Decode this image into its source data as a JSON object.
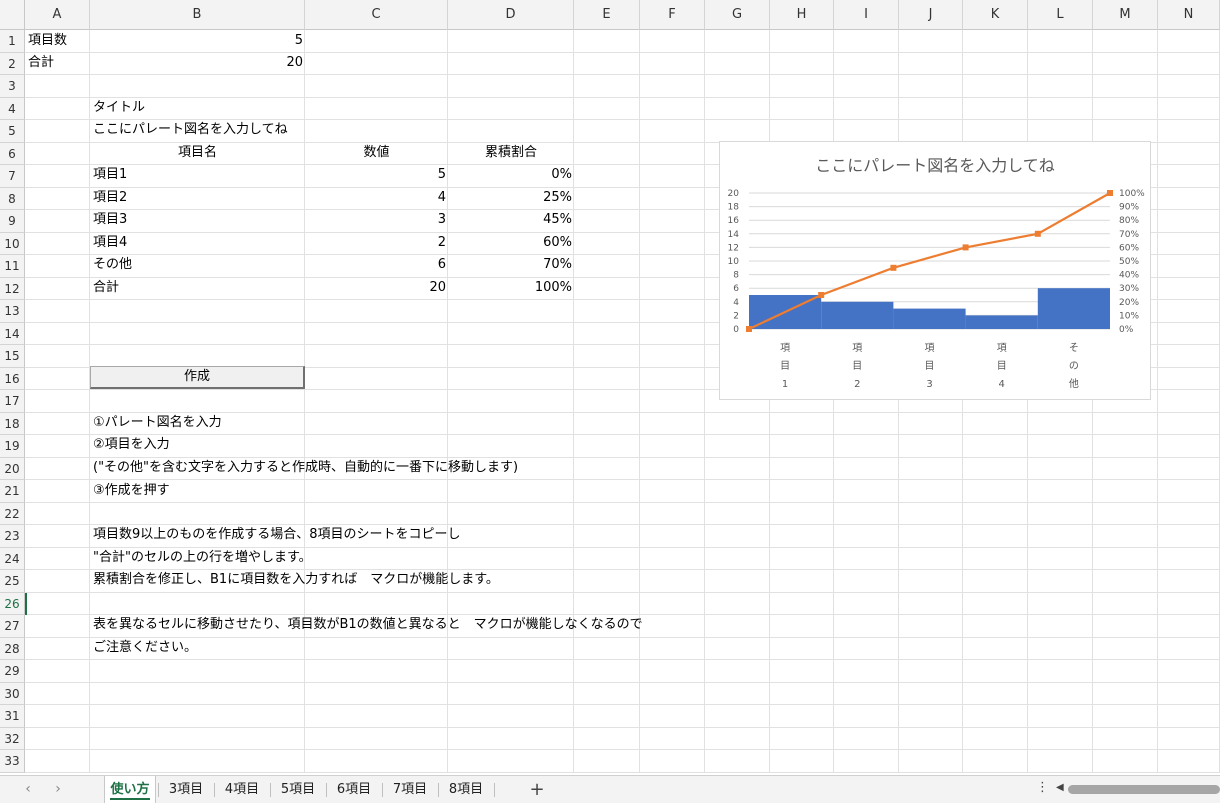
{
  "columns": [
    "A",
    "B",
    "C",
    "D",
    "E",
    "F",
    "G",
    "H",
    "I",
    "J",
    "K",
    "L",
    "M",
    "N"
  ],
  "rows": [
    "1",
    "2",
    "3",
    "4",
    "5",
    "6",
    "7",
    "8",
    "9",
    "10",
    "11",
    "12",
    "13",
    "14",
    "15",
    "16",
    "17",
    "18",
    "19",
    "20",
    "21",
    "22",
    "23",
    "24",
    "25",
    "26",
    "27",
    "28",
    "29",
    "30",
    "31",
    "32",
    "33"
  ],
  "cells": {
    "a1": "項目数",
    "b1": "5",
    "a2": "合計",
    "b2": "20",
    "b4": "タイトル",
    "b5": "ここにパレート図名を入力してね",
    "b6": "項目名",
    "c6": "数値",
    "d6": "累積割合",
    "b7": "項目1",
    "c7": "5",
    "d7": "0%",
    "b8": "項目2",
    "c8": "4",
    "d8": "25%",
    "b9": "項目3",
    "c9": "3",
    "d9": "45%",
    "b10": "項目4",
    "c10": "2",
    "d10": "60%",
    "b11": "その他",
    "c11": "6",
    "d11": "70%",
    "b12": "合計",
    "c12": "20",
    "d12": "100%"
  },
  "create_button": "作成",
  "instructions": {
    "r18": "①パレート図名を入力",
    "r19": "②項目を入力",
    "r20": "(\"その他\"を含む文字を入力すると作成時、自動的に一番下に移動します)",
    "r21": "③作成を押す",
    "r23": "項目数9以上のものを作成する場合、8項目のシートをコピーし",
    "r24": "\"合計\"のセルの上の行を増やします。",
    "r25": "累積割合を修正し、B1に項目数を入力すれば　マクロが機能します。",
    "r27": "表を異なるセルに移動させたり、項目数がB1の数値と異なると　マクロが機能しなくなるので",
    "r28": "ご注意ください。"
  },
  "chart_data": {
    "type": "bar",
    "title": "ここにパレート図名を入力してね",
    "categories": [
      "項目1",
      "項目2",
      "項目3",
      "項目4",
      "その他"
    ],
    "category_lines": [
      [
        "項",
        "目",
        "1"
      ],
      [
        "項",
        "目",
        "2"
      ],
      [
        "項",
        "目",
        "3"
      ],
      [
        "項",
        "目",
        "4"
      ],
      [
        "そ",
        "の",
        "他"
      ]
    ],
    "series": [
      {
        "type": "bar",
        "values": [
          5,
          4,
          3,
          2,
          6
        ],
        "color": "#4472c4"
      },
      {
        "type": "line",
        "axis": "secondary",
        "x": [
          0,
          1,
          2,
          3,
          4,
          5
        ],
        "values": [
          0,
          25,
          45,
          60,
          70,
          100
        ],
        "color": "#ed7d31"
      }
    ],
    "y_left": {
      "min": 0,
      "max": 20,
      "ticks": [
        "0",
        "2",
        "4",
        "6",
        "8",
        "10",
        "12",
        "14",
        "16",
        "18",
        "20"
      ]
    },
    "y_right": {
      "min": 0,
      "max": 100,
      "ticks": [
        "0%",
        "10%",
        "20%",
        "30%",
        "40%",
        "50%",
        "60%",
        "70%",
        "80%",
        "90%",
        "100%"
      ]
    },
    "grid": true
  },
  "sheet_tabs": [
    "使い方",
    "3項目",
    "4項目",
    "5項目",
    "6項目",
    "7項目",
    "8項目"
  ],
  "active_tab": "使い方",
  "icons": {
    "prev": "chevron-left-icon",
    "next": "chevron-right-icon",
    "add": "plus-icon"
  },
  "colors": {
    "accent": "#1e7145"
  }
}
